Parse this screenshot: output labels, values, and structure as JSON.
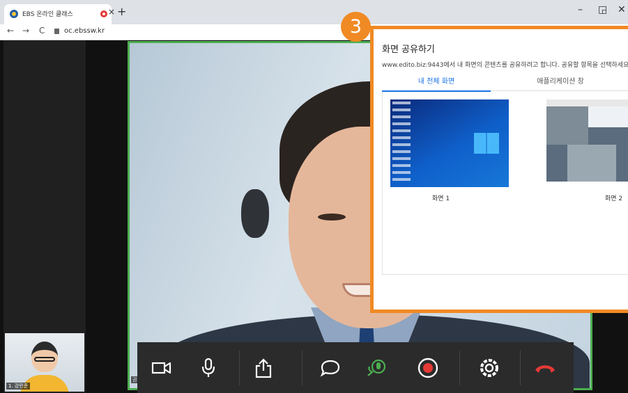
{
  "browser": {
    "tab_title": "EBS 온라인 클래스",
    "tab_close": "×",
    "new_tab": "+",
    "url": "oc.ebssw.kr",
    "back": "←",
    "forward": "→",
    "reload": "C",
    "minimize": "–",
    "maximize": "◲",
    "close": "✕"
  },
  "step_badge": "3",
  "share_dialog": {
    "title": "화면 공유하기",
    "description": "www.edito.biz:9443에서 내 화면의 콘텐츠를 공유하려고 합니다. 공유할 항목을 선택하세요.",
    "tabs": [
      "내 전체 화면",
      "애플리케이션 창"
    ],
    "screens": [
      "화면 1",
      "화면 2"
    ]
  },
  "self_view": {
    "name": "1. 강민준"
  },
  "main_label": "권",
  "toolbar": {
    "buttons": [
      "camera-icon",
      "microphone-icon",
      "share-icon",
      "chat-icon",
      "voice-share-icon",
      "record-icon",
      "settings-icon",
      "hang-up-icon"
    ],
    "colors": {
      "active": "#4caf50",
      "record": "#e53935",
      "hangup": "#e53935",
      "default": "#ffffff"
    }
  }
}
